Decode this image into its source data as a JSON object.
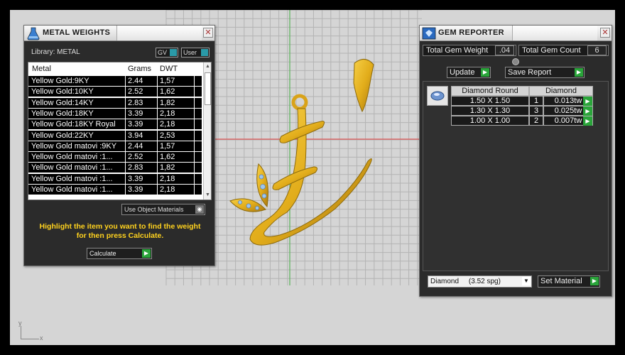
{
  "metal_weights": {
    "title": "METAL WEIGHTS",
    "library_label": "Library: METAL",
    "toggle_gv": "GV",
    "toggle_user": "User",
    "columns": [
      "Metal",
      "Grams",
      "DWT"
    ],
    "rows": [
      [
        "Yellow Gold:9KY",
        "2.44",
        "1,57"
      ],
      [
        "Yellow Gold:10KY",
        "2.52",
        "1,62"
      ],
      [
        "Yellow Gold:14KY",
        "2.83",
        "1,82"
      ],
      [
        "Yellow Gold:18KY",
        "3.39",
        "2,18"
      ],
      [
        "Yellow Gold:18KY Royal",
        "3.39",
        "2,18"
      ],
      [
        "Yellow Gold:22KY",
        "3.94",
        "2,53"
      ],
      [
        "Yellow Gold matovi :9KY",
        "2.44",
        "1,57"
      ],
      [
        "Yellow Gold matovi :1...",
        "2.52",
        "1,62"
      ],
      [
        "Yellow Gold matovi :1...",
        "2.83",
        "1,82"
      ],
      [
        "Yellow Gold matovi :1...",
        "3.39",
        "2,18"
      ],
      [
        "Yellow Gold matovi :1...",
        "3.39",
        "2,18"
      ]
    ],
    "use_object_materials": "Use Object Materials",
    "hint_line1": "Highlight the item you want to find the weight",
    "hint_line2": "for then press Calculate.",
    "calculate_label": "Calculate"
  },
  "gem_reporter": {
    "title": "GEM REPORTER",
    "total_weight_label": "Total Gem Weight",
    "total_weight_value": ".04",
    "total_count_label": "Total Gem Count",
    "total_count_value": "6",
    "update_label": "Update",
    "save_report_label": "Save Report",
    "table_head": [
      "Diamond Round",
      "Diamond"
    ],
    "gems": [
      {
        "size": "1.50 X 1.50",
        "qty": "1",
        "weight": "0.013tw"
      },
      {
        "size": "1.30 X 1.30",
        "qty": "3",
        "weight": "0.025tw"
      },
      {
        "size": "1.00 X 1.00",
        "qty": "2",
        "weight": "0.007tw"
      }
    ],
    "material_select": "Diamond     (3.52 spg)",
    "set_material_label": "Set Material"
  },
  "axis": {
    "y": "y",
    "x": "x"
  },
  "colors": {
    "gold": "#e2ad1b",
    "accent_green": "#2aa53a",
    "accent_teal": "#2a9aa8",
    "hint_yellow": "#ffd21e"
  },
  "icons": [
    "flask-icon",
    "gem-reporter-icon",
    "close-icon",
    "go-arrow-icon",
    "dropdown-arrow-icon",
    "gem-shape-icon"
  ]
}
